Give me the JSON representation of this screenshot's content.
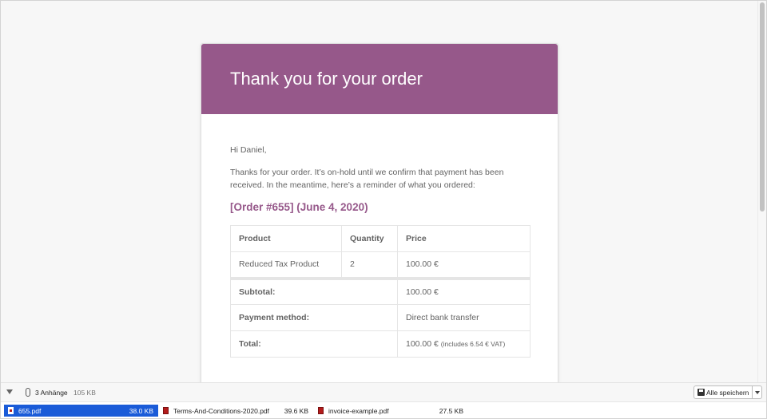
{
  "email": {
    "header_title": "Thank you for your order",
    "greeting": "Hi Daniel,",
    "intro": "Thanks for your order. It’s on-hold until we confirm that payment has been received. In the meantime, here’s a reminder of what you ordered:",
    "order_heading": "[Order #655] (June 4, 2020)",
    "table": {
      "headers": [
        "Product",
        "Quantity",
        "Price"
      ],
      "items": [
        {
          "product": "Reduced Tax Product",
          "quantity": "2",
          "price": "100.00 €"
        }
      ],
      "totals": [
        {
          "label": "Subtotal:",
          "value": "100.00 €",
          "note": ""
        },
        {
          "label": "Payment method:",
          "value": "Direct bank transfer",
          "note": ""
        },
        {
          "label": "Total:",
          "value": "100.00 €",
          "note": "(includes 6.54 € VAT)"
        }
      ]
    }
  },
  "attachments": {
    "count_label": "3 Anhänge",
    "total_size": "105 KB",
    "save_all_label": "Alle speichern",
    "files": [
      {
        "name": "655.pdf",
        "size": "38.0 KB",
        "selected": true
      },
      {
        "name": "Terms-And-Conditions-2020.pdf",
        "size": "39.6 KB",
        "selected": false
      },
      {
        "name": "invoice-example.pdf",
        "size": "27.5 KB",
        "selected": false
      }
    ]
  },
  "colors": {
    "brand": "#96588a",
    "selection": "#1a5bd8",
    "text": "#636363"
  }
}
